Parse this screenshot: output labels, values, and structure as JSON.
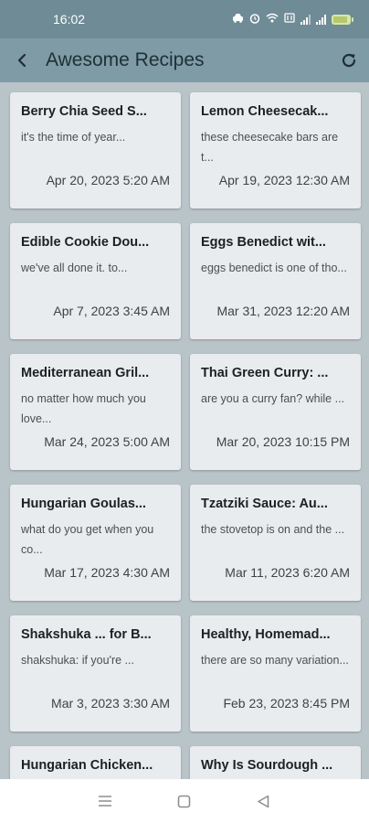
{
  "status": {
    "time": "16:02",
    "battery_color": "#d6e7a7"
  },
  "app": {
    "title": "Awesome Recipes",
    "back_icon": "arrow-back-icon",
    "refresh_icon": "refresh-icon",
    "appbar_color": "#7f9ba5"
  },
  "recipes": [
    {
      "title": "Berry Chia Seed S...",
      "snippet": "it's the time of year...",
      "date": "Apr 20, 2023 5:20 AM"
    },
    {
      "title": "Lemon Cheesecak...",
      "snippet": "these cheesecake bars are t...",
      "date": "Apr 19, 2023 12:30 AM"
    },
    {
      "title": "Edible Cookie Dou...",
      "snippet": "we've all done it. to...",
      "date": "Apr 7, 2023 3:45 AM"
    },
    {
      "title": "Eggs Benedict wit...",
      "snippet": "eggs benedict is one of tho...",
      "date": "Mar 31, 2023 12:20 AM"
    },
    {
      "title": "Mediterranean Gril...",
      "snippet": "no matter how much you love...",
      "date": "Mar 24, 2023 5:00 AM"
    },
    {
      "title": "Thai Green Curry: ...",
      "snippet": "are you a curry fan? while ...",
      "date": "Mar 20, 2023 10:15 PM"
    },
    {
      "title": "Hungarian Goulas...",
      "snippet": "what do you get when you co...",
      "date": "Mar 17, 2023 4:30 AM"
    },
    {
      "title": "Tzatziki Sauce: Au...",
      "snippet": "the stovetop is on and the ...",
      "date": "Mar 11, 2023 6:20 AM"
    },
    {
      "title": "Shakshuka ... for B...",
      "snippet": "shakshuka: if you're ...",
      "date": "Mar 3, 2023 3:30 AM"
    },
    {
      "title": "Healthy, Homemad...",
      "snippet": "there are so many variation...",
      "date": "Feb 23, 2023 8:45 PM"
    },
    {
      "title": "Hungarian Chicken...",
      "snippet": "",
      "date": ""
    },
    {
      "title": "Why Is Sourdough ...",
      "snippet": "",
      "date": ""
    }
  ],
  "nav": {
    "menu_icon": "menu-icon",
    "home_icon": "home-square-icon",
    "back_icon": "back-triangle-icon"
  }
}
